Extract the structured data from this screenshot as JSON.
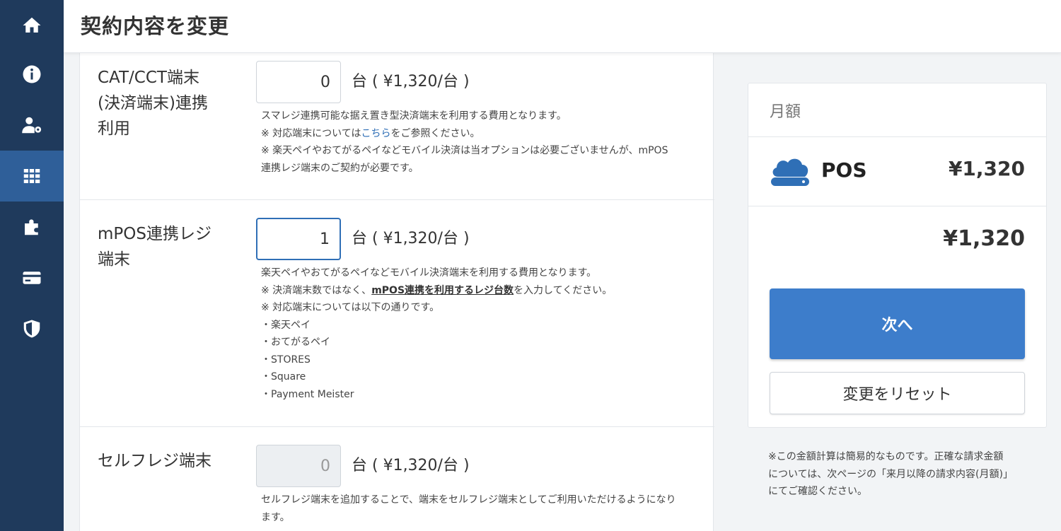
{
  "sidebar": {
    "items": [
      {
        "icon": "home-icon"
      },
      {
        "icon": "info-icon"
      },
      {
        "icon": "user-settings-icon"
      },
      {
        "icon": "grid-icon",
        "active": true
      },
      {
        "icon": "puzzle-icon"
      },
      {
        "icon": "credit-card-icon"
      },
      {
        "icon": "shield-icon"
      }
    ]
  },
  "header": {
    "title": "契約内容を変更"
  },
  "rows": [
    {
      "label_lines": [
        "CAT/CCT端末",
        "(決済端末)連携",
        "利用"
      ],
      "value": "0",
      "unit": "台 ( ¥1,320/台 )",
      "desc": {
        "line1": "スマレジ連携可能な据え置き型決済端末を利用する費用となります。",
        "line2_pre": "※ 対応端末については",
        "line2_link": "こちら",
        "line2_post": "をご参照ください。",
        "line3": "※ 楽天ペイやおてがるペイなどモバイル決済は当オプションは必要ございませんが、mPOS",
        "line4": "連携レジ端末のご契約が必要です。"
      }
    },
    {
      "label_lines": [
        "mPOS連携レジ",
        "端末"
      ],
      "value": "1",
      "unit": "台 ( ¥1,320/台 )",
      "desc": {
        "line1": "楽天ペイやおてがるペイなどモバイル決済端末を利用する費用となります。",
        "line2_pre": "※ 決済端末数ではなく、",
        "line2_strong": "mPOS連携を利用するレジ台数",
        "line2_post": "を入力してください。",
        "line3": "※ 対応端末については以下の通りです。",
        "list": [
          "・楽天ペイ",
          "・おてがるペイ",
          "・STORES",
          "・Square",
          "・Payment Meister"
        ]
      }
    },
    {
      "label_lines": [
        "セルフレジ端末"
      ],
      "value": "0",
      "unit": "台 ( ¥1,320/台 )",
      "desc": {
        "line1": "セルフレジ端末を追加することで、端末をセルフレジ端末としてご利用いただけるようになり",
        "line2": "ます。"
      }
    }
  ],
  "summary": {
    "heading": "月額",
    "item_name": "POS",
    "item_price": "¥1,320",
    "total": "¥1,320",
    "next_label": "次へ",
    "reset_label": "変更をリセット"
  },
  "note": {
    "line1": "※この金額計算は簡易的なものです。正確な請求金額",
    "line2": "については、次ページの「来月以降の請求内容(月額)」",
    "line3": "にてご確認ください。"
  },
  "colors": {
    "sidebar_bg": "#1f3a5c",
    "sidebar_active": "#2f5f99",
    "primary": "#3d7dcb",
    "link": "#2f6fb6"
  }
}
